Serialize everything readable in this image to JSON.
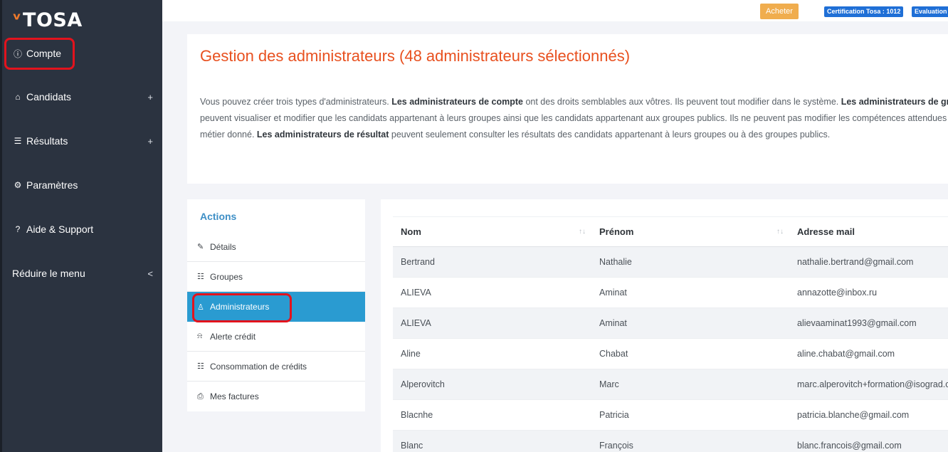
{
  "brand": {
    "mark": "ˠ",
    "name": "TOSA"
  },
  "sidebar": {
    "items": [
      {
        "label": "Compte",
        "icon": "info-circle-icon",
        "glyph": "ⓘ",
        "expand": ""
      },
      {
        "label": "Candidats",
        "icon": "user-icon",
        "glyph": "⌂",
        "expand": "+"
      },
      {
        "label": "Résultats",
        "icon": "list-icon",
        "glyph": "☰",
        "expand": "+"
      },
      {
        "label": "Paramètres",
        "icon": "gear-icon",
        "glyph": "⚙",
        "expand": ""
      },
      {
        "label": "Aide & Support",
        "icon": "question-circle-icon",
        "glyph": "?",
        "expand": ""
      },
      {
        "label": "Réduire le menu",
        "icon": "",
        "glyph": "",
        "expand": "<"
      }
    ]
  },
  "topbar": {
    "buy_label": "Acheter",
    "badges": [
      "Certification Tosa : 1012",
      "Evaluation"
    ]
  },
  "header": {
    "title": "Gestion des administrateurs (48 administrateurs sélectionnés)",
    "intro": {
      "l1a": "Vous pouvez créer trois types d'administrateurs. ",
      "l1b": "Les administrateurs de compte",
      "l1c": " ont des droits semblables aux vôtres. Ils peuvent tout modifier dans le système. ",
      "l1d": "Les administrateurs de grou",
      "l2": "peuvent visualiser et modifier que les candidats appartenant à leurs groupes ainsi que les candidats appartenant aux groupes publics. Ils ne peuvent pas modifier les compétences attendues",
      "l3a": "métier donné. ",
      "l3b": "Les administrateurs de résultat",
      "l3c": " peuvent seulement consulter les résultats des candidats appartenant à leurs groupes ou à des groupes publics."
    }
  },
  "actions": {
    "title": "Actions",
    "items": [
      {
        "label": "Détails",
        "icon": "edit-icon",
        "glyph": "✎"
      },
      {
        "label": "Groupes",
        "icon": "groups-icon",
        "glyph": "☷"
      },
      {
        "label": "Administrateurs",
        "icon": "admin-user-icon",
        "glyph": "♙"
      },
      {
        "label": "Alerte crédit",
        "icon": "bell-icon",
        "glyph": "⍾"
      },
      {
        "label": "Consommation de crédits",
        "icon": "credits-icon",
        "glyph": "☷"
      },
      {
        "label": "Mes factures",
        "icon": "invoice-icon",
        "glyph": "⎙"
      }
    ]
  },
  "table": {
    "columns": [
      "Nom",
      "Prénom",
      "Adresse mail"
    ],
    "sort_glyph": "↑↓",
    "rows": [
      [
        "Bertrand",
        "Nathalie",
        "nathalie.bertrand@gmail.com"
      ],
      [
        "ALIEVA",
        "Aminat",
        "annazotte@inbox.ru"
      ],
      [
        "ALIEVA",
        "Aminat",
        "alievaaminat1993@gmail.com"
      ],
      [
        "Aline",
        "Chabat",
        "aline.chabat@gmail.com"
      ],
      [
        "Alperovitch",
        "Marc",
        "marc.alperovitch+formation@isograd.com"
      ],
      [
        "Blacnhe",
        "Patricia",
        "patricia.blanche@gmail.com"
      ],
      [
        "Blanc",
        "François",
        "blanc.francois@gmail.com"
      ]
    ]
  },
  "colors": {
    "sidebar": "#2b3340",
    "accent": "#e8501f",
    "active": "#2a9bd1",
    "highlight": "#e2131d"
  }
}
